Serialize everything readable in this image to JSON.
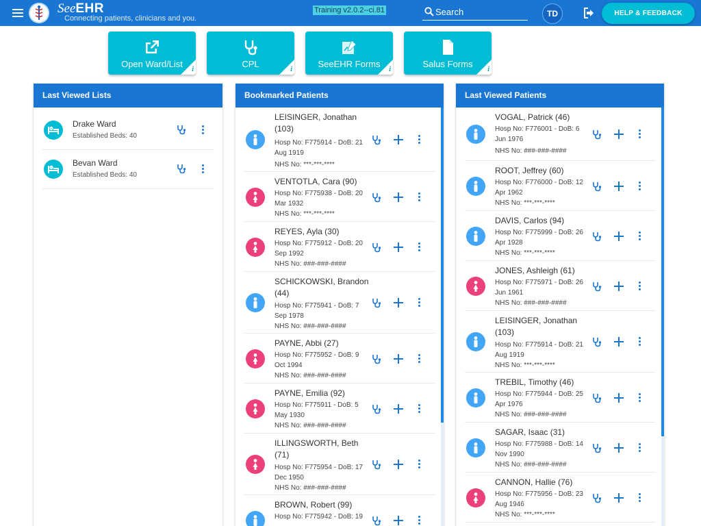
{
  "header": {
    "brand_prefix": "See",
    "brand_suffix": "EHR",
    "tagline": "Connecting patients, clinicians and you.",
    "version": "Training v2.0.2--ci.81",
    "search_placeholder": "Search",
    "user_initials": "TD",
    "help_label": "HELP & FEEDBACK",
    "colors": {
      "bar": "#1976d2",
      "accent": "#00bcd4"
    }
  },
  "tiles": [
    {
      "label": "Open Ward/List",
      "icon": "open-external-icon"
    },
    {
      "label": "CPL",
      "icon": "stethoscope-icon"
    },
    {
      "label": "SeeEHR Forms",
      "icon": "form-edit-icon"
    },
    {
      "label": "Salus Forms",
      "icon": "document-icon"
    }
  ],
  "last_viewed_lists": {
    "title": "Last Viewed Lists",
    "items": [
      {
        "name": "Drake Ward",
        "sub": "Established Beds: 40"
      },
      {
        "name": "Bevan Ward",
        "sub": "Established Beds: 40"
      }
    ]
  },
  "bookmarked_patients": {
    "title": "Bookmarked Patients",
    "items": [
      {
        "name": "LEISINGER, Jonathan (103)",
        "detail": "Hosp No: F775914 - DoB: 21 Aug 1919",
        "nhs": "NHS No: ***-***-****",
        "gender": "m"
      },
      {
        "name": "VENTOTLA, Cara (90)",
        "detail": "Hosp No: F775938 - DoB: 20 Mar 1932",
        "nhs": "NHS No: ***-***-****",
        "gender": "f"
      },
      {
        "name": "REYES, Ayla (30)",
        "detail": "Hosp No: F775912 - DoB: 20 Sep 1992",
        "nhs": "NHS No: ###-###-####",
        "gender": "f"
      },
      {
        "name": "SCHICKOWSKI, Brandon (44)",
        "detail": "Hosp No: F775941 - DoB: 7 Sep 1978",
        "nhs": "NHS No: ###-###-####",
        "gender": "m"
      },
      {
        "name": "PAYNE, Abbi (27)",
        "detail": "Hosp No: F775952 - DoB: 9 Oct 1994",
        "nhs": "NHS No: ###-###-####",
        "gender": "f"
      },
      {
        "name": "PAYNE, Emilia (92)",
        "detail": "Hosp No: F775911 - DoB: 5 May 1930",
        "nhs": "NHS No: ###-###-####",
        "gender": "f"
      },
      {
        "name": "ILLINGSWORTH, Beth (71)",
        "detail": "Hosp No: F775954 - DoB: 17 Dec 1950",
        "nhs": "NHS No: ###-###-####",
        "gender": "f"
      },
      {
        "name": "BROWN, Robert (99)",
        "detail": "Hosp No: F775942 - DoB: 19",
        "nhs": "",
        "gender": "m"
      }
    ]
  },
  "last_viewed_patients": {
    "title": "Last Viewed Patients",
    "items": [
      {
        "name": "VOGAL, Patrick (46)",
        "detail": "Hosp No: F776001 - DoB: 6 Jun 1976",
        "nhs": "NHS No: ###-###-####",
        "gender": "m"
      },
      {
        "name": "ROOT, Jeffrey (60)",
        "detail": "Hosp No: F776000 - DoB: 12 Apr 1962",
        "nhs": "NHS No: ***-***-****",
        "gender": "m"
      },
      {
        "name": "DAVIS, Carlos (94)",
        "detail": "Hosp No: F775999 - DoB: 26 Apr 1928",
        "nhs": "NHS No: ***-***-****",
        "gender": "m"
      },
      {
        "name": "JONES, Ashleigh (61)",
        "detail": "Hosp No: F775971 - DoB: 26 Jun 1961",
        "nhs": "NHS No: ###-###-####",
        "gender": "f"
      },
      {
        "name": "LEISINGER, Jonathan (103)",
        "detail": "Hosp No: F775914 - DoB: 21 Aug 1919",
        "nhs": "NHS No: ***-***-****",
        "gender": "m"
      },
      {
        "name": "TREBIL, Timothy (46)",
        "detail": "Hosp No: F775944 - DoB: 25 Apr 1976",
        "nhs": "NHS No: ###-###-####",
        "gender": "m"
      },
      {
        "name": "SAGAR, Isaac (31)",
        "detail": "Hosp No: F775988 - DoB: 14 Nov 1990",
        "nhs": "NHS No: ###-###-####",
        "gender": "m"
      },
      {
        "name": "CANNON, Hallie (76)",
        "detail": "Hosp No: F775956 - DoB: 23 Aug 1946",
        "nhs": "NHS No: ***-***-****",
        "gender": "f"
      }
    ]
  }
}
